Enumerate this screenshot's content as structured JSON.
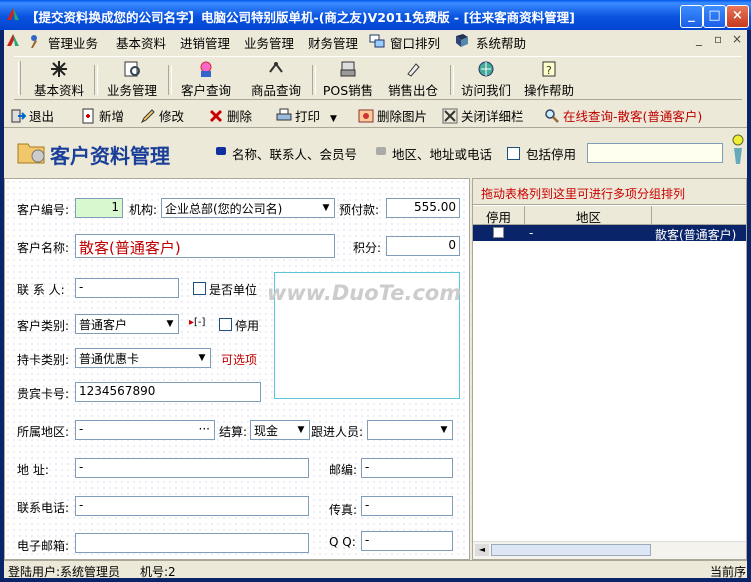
{
  "window": {
    "title": "【提交资料换成您的公司名字】电脑公司特别版单机-(商之友)V2011免费版 - [往来客商资料管理]",
    "minimize": "_",
    "maximize": "□",
    "close": "×"
  },
  "menubar": {
    "items": [
      "管理业务",
      "基本资料",
      "进销管理",
      "业务管理",
      "财务管理",
      "窗口排列",
      "系统帮助"
    ],
    "mdi_min": "_",
    "mdi_restore": "▫",
    "mdi_close": "×"
  },
  "big_toolbar": [
    "基本资料",
    "业务管理",
    "客户查询",
    "商品查询",
    "POS销售",
    "销售出仓",
    "访问我们",
    "操作帮助"
  ],
  "small_toolbar": {
    "exit": "退出",
    "add": "新增",
    "edit": "修改",
    "delete": "删除",
    "print": "打印",
    "delete_image": "删除图片",
    "close_detail": "关闭详细栏",
    "online_query": "在线查询-散客(普通客户)"
  },
  "header": {
    "title": "客户资料管理",
    "option1": "名称、联系人、会员号",
    "option2": "地区、地址或电话",
    "include_disabled": "包括停用",
    "search_value": ""
  },
  "form": {
    "customer_no_label": "客户编号:",
    "customer_no": "1",
    "org_label": "机构:",
    "org_value": "企业总部(您的公司名)",
    "prepaid_label": "预付款:",
    "prepaid_value": "555.00",
    "name_label": "客户名称:",
    "name_value": "散客(普通客户)",
    "points_label": "积分:",
    "points_value": "0",
    "contact_label": "联 系 人:",
    "contact_value": "-",
    "is_company": "是否单位",
    "category_label": "客户类别:",
    "category_value": "普通客户",
    "category_more": "[-]",
    "disabled": "停用",
    "card_type_label": "持卡类别:",
    "card_type_value": "普通优惠卡",
    "optional_note": "可选项",
    "vip_label": "贵宾卡号:",
    "vip_value": "1234567890",
    "region_label": "所属地区:",
    "region_value": "-",
    "region_btn": "···",
    "settle_label": "结算:",
    "settle_value": "现金",
    "follow_label": "跟进人员:",
    "follow_value": "",
    "address_label": "地    址:",
    "address_value": "-",
    "zip_label": "邮编:",
    "zip_value": "-",
    "phone_label": "联系电话:",
    "phone_value": "-",
    "fax_label": "传真:",
    "fax_value": "-",
    "email_label": "电子邮箱:",
    "email_value": "",
    "qq_label": "Q Q:",
    "qq_value": "-",
    "watermark": "www.DuoTe.com"
  },
  "grid": {
    "group_hint": "拖动表格列到这里可进行多项分组排列",
    "columns": [
      "停用",
      "地区"
    ],
    "rows": [
      {
        "region": "-",
        "name": "散客(普通客户)"
      }
    ]
  },
  "status": {
    "user_label": "登陆用户:",
    "user_value": "系统管理员",
    "machine_label": "机号:",
    "machine_value": "2",
    "right_text": "当前序"
  },
  "colors": {
    "titlebar": "#0a54e0",
    "page_title": "#1a3f9a",
    "warning_red": "#c00000",
    "selection": "#0a246a"
  }
}
